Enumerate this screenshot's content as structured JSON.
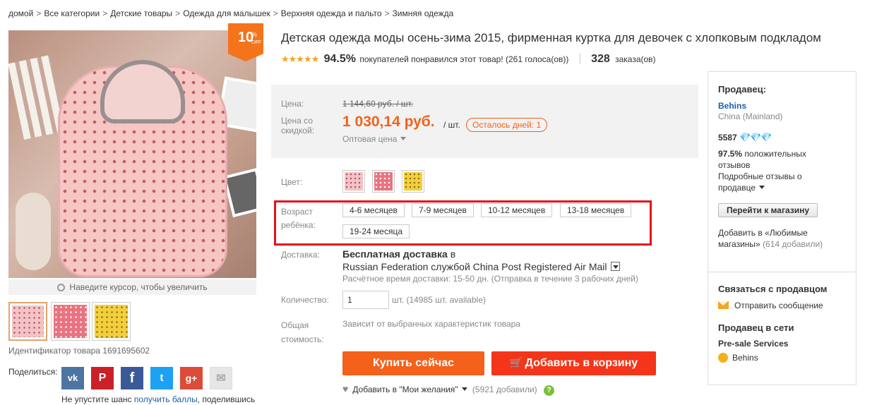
{
  "breadcrumb": {
    "items": [
      "домой",
      "Все категории",
      "Детские товары",
      "Одежда для малышек",
      "Верхняя одежда и пальто",
      "Зимняя одежда"
    ],
    "separator": ">"
  },
  "badge": {
    "num": "10",
    "pct": "%",
    "off": "OFF"
  },
  "gallery": {
    "zoom_hint": "Наведите курсор, чтобы увеличить",
    "thumb_count": 3,
    "product_id": "Идентификатор товара 1691695602"
  },
  "share": {
    "label": "Поделиться:",
    "networks": [
      "vk",
      "pinterest",
      "facebook",
      "twitter",
      "google-plus",
      "email"
    ],
    "note_prefix": "Не упустите шанс ",
    "note_link": "получить баллы",
    "note_suffix": ", поделившись"
  },
  "product": {
    "title": "Детская одежда моды осень-зима 2015, фирменная куртка для девочек с хлопковым подкладом",
    "stars": "★★★★★",
    "rating_pct": "94.5%",
    "rating_text": "покупателей понравился этот товар! (261 голоса(ов))",
    "orders_num": "328",
    "orders_label": "заказа(ов)"
  },
  "price": {
    "price_label": "Цена:",
    "old_price": "1 144,60 руб. / шт.",
    "discount_label_1": "Цена со",
    "discount_label_2": "скидкой:",
    "new_price": "1 030,14 руб.",
    "unit": "/ шт.",
    "days_left": "Осталось дней: 1",
    "wholesale": "Оптовая цена"
  },
  "options": {
    "color_label": "Цвет:",
    "colors": [
      "#f3c3c6",
      "#e9737f",
      "#f3cf3c"
    ],
    "age_label_1": "Возраст",
    "age_label_2": "ребёнка:",
    "sizes": [
      "4-6 месяцев",
      "7-9 месяцев",
      "10-12 месяцев",
      "13-18 месяцев",
      "19-24 месяца"
    ]
  },
  "delivery": {
    "label": "Доставка:",
    "free": "Бесплатная доставка",
    "free_suffix": "в",
    "method": "Russian Federation службой China Post Registered Air Mail",
    "time": "Расчётное время доставки: 15-50 дн. (Отправка в течение 3 рабочих дней)"
  },
  "quantity": {
    "label": "Количество:",
    "value": "1",
    "available": "шт. (14985 шт. available)"
  },
  "total": {
    "label_1": "Общая",
    "label_2": "стоимость:",
    "value": "Зависит от выбранных характеристик товара"
  },
  "actions": {
    "buy_now": "Купить сейчас",
    "add_to_cart": "Добавить в корзину",
    "wishlist": "Добавить в \"Мои желания\"",
    "wishlist_count": "(5921 добавили)",
    "help": "?"
  },
  "seller": {
    "heading": "Продавец:",
    "name": "Behins",
    "location": "China (Mainland)",
    "score": "5587",
    "diamonds": "💎💎💎",
    "positive_pct": "97.5%",
    "positive_label": "положительных",
    "positive_label_2": "отзывов",
    "detailed_1": "Подробные отзывы о",
    "detailed_2": "продавце",
    "go_to_store": "Перейти к магазину",
    "fav_1": "Добавить в «Любимые",
    "fav_2": "магазины»",
    "fav_count": "(614 добавили)",
    "contact_heading": "Связаться с продавцом",
    "send_message": "Отправить сообщение",
    "online_heading": "Продавец в сети",
    "presale": "Pre-sale Services",
    "presale_name": "Behins"
  }
}
